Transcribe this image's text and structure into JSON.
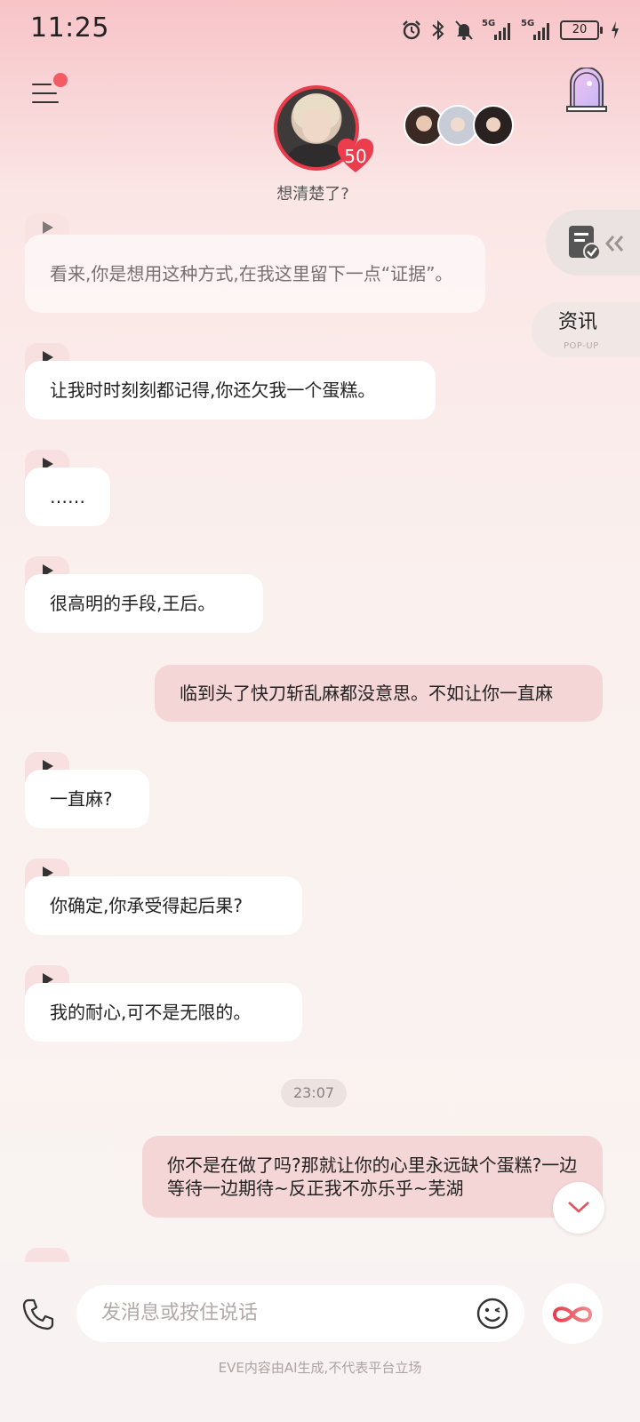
{
  "status_bar": {
    "time": "11:25",
    "battery": "20",
    "signal_label_1": "5G",
    "signal_label_2": "5G"
  },
  "header": {
    "level": "50",
    "mood_text": "想清楚了?"
  },
  "side": {
    "news_label": "资讯",
    "news_sub": "POP-UP"
  },
  "messages": [
    {
      "from": "character",
      "text": "看来,你是想用这种方式,在我这里留下一点“证据”。"
    },
    {
      "from": "character",
      "text": "让我时时刻刻都记得,你还欠我一个蛋糕。"
    },
    {
      "from": "character",
      "text": "……"
    },
    {
      "from": "character",
      "text": "很高明的手段,王后。"
    },
    {
      "from": "user",
      "text": "临到头了快刀斩乱麻都没意思。不如让你一直麻"
    },
    {
      "from": "character",
      "text": "一直麻?"
    },
    {
      "from": "character",
      "text": "你确定,你承受得起后果?"
    },
    {
      "from": "character",
      "text": "我的耐心,可不是无限的。"
    },
    {
      "from": "user",
      "text": "你不是在做了吗?那就让你的心里永远缺个蛋糕?一边等待一边期待~反正我不亦乐乎~芜湖"
    }
  ],
  "timestamp": "23:07",
  "input": {
    "placeholder": "发消息或按住说话"
  },
  "disclaimer": "EVE内容由AI生成,不代表平台立场",
  "colors": {
    "accent": "#e83c4a",
    "user_bubble": "#f5d6d6",
    "play_tab": "#f8dfe0"
  }
}
